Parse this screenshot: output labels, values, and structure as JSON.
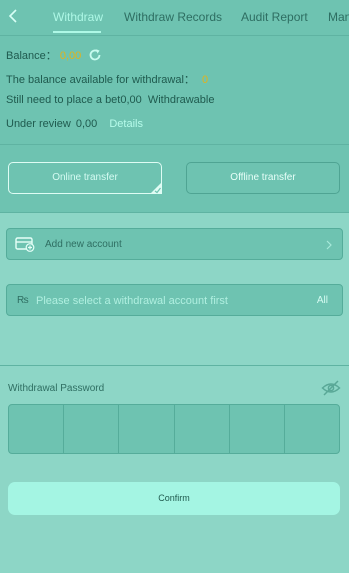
{
  "tabs": [
    {
      "label": "Withdraw",
      "active": true
    },
    {
      "label": "Withdraw Records",
      "active": false
    },
    {
      "label": "Audit Report",
      "active": false
    },
    {
      "label": "Man",
      "active": false
    }
  ],
  "balance": {
    "label": "Balance：",
    "value": "0,00"
  },
  "available": {
    "label": "The balance available for withdrawal：",
    "value": "0"
  },
  "bet_needed": {
    "prefix": "Still need to place a bet",
    "value": "0,00",
    "suffix": "Withdrawable"
  },
  "under_review": {
    "label": "Under review",
    "value": "0,00",
    "details": "Details"
  },
  "transfer": {
    "online": "Online transfer",
    "offline": "Offline transfer"
  },
  "add_account": {
    "label": "Add new account"
  },
  "select_account": {
    "currency_symbol": "₨",
    "placeholder": "Please select a withdrawal account first",
    "all_label": "All"
  },
  "password": {
    "label": "Withdrawal Password",
    "cells": 6
  },
  "confirm_label": "Confirm",
  "colors": {
    "background": "#8dd6c6",
    "panel": "#6ec3b1",
    "accent": "#aef8e6",
    "gold": "#e3b31a",
    "confirm": "#a4f5e3"
  }
}
